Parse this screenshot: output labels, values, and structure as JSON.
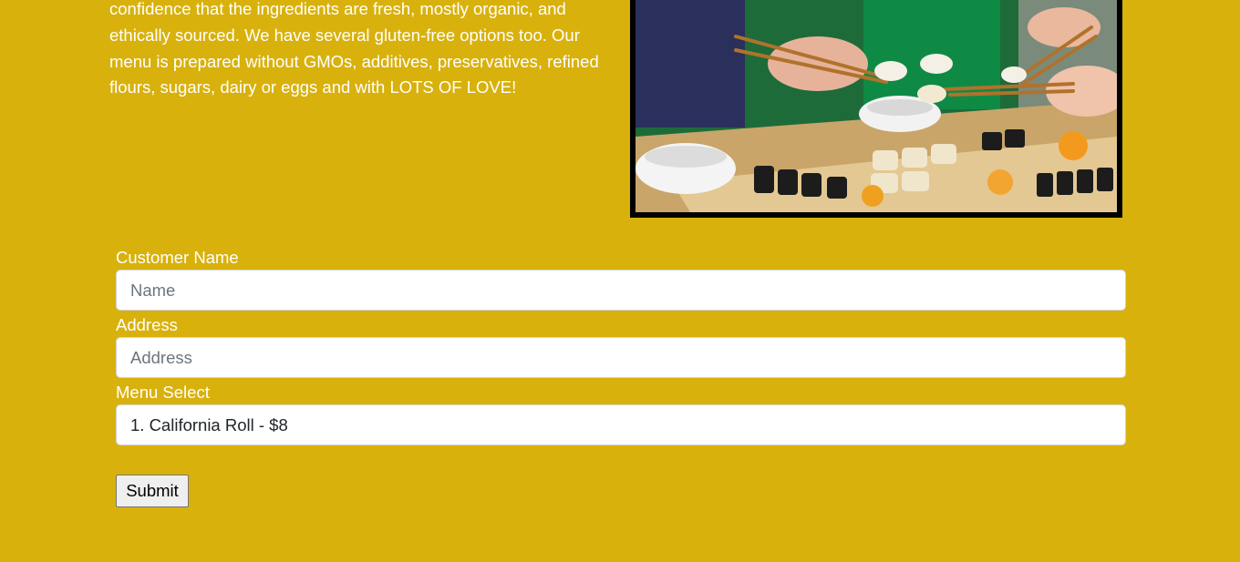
{
  "intro": {
    "text": "confidence that the ingredients are fresh, mostly organic, and ethically sourced. We have several gluten-free options too. Our menu is prepared without GMOs, additives, preservatives, refined flours, sugars, dairy or eggs and with LOTS OF LOVE!"
  },
  "photo": {
    "alt": "People eating sushi with chopsticks"
  },
  "form": {
    "name_label": "Customer Name",
    "name_placeholder": "Name",
    "name_value": "",
    "address_label": "Address",
    "address_placeholder": "Address",
    "address_value": "",
    "menu_label": "Menu Select",
    "menu_selected": "1. California Roll - $8",
    "submit_label": "Submit"
  },
  "colors": {
    "background": "#d9b10c",
    "text": "#ffffff",
    "photo_border": "#000000"
  }
}
